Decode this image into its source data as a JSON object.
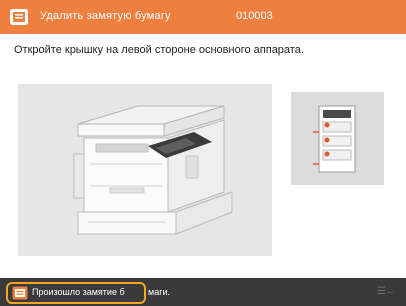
{
  "header": {
    "title": "Удалить замятую бумагу",
    "error_code": "010003",
    "accent_color": "#ef7f3f",
    "icon": "paper-jam-icon"
  },
  "instruction": "Откройте крышку на левой стороне основного аппарата.",
  "illustration": {
    "main": "printer-illustration",
    "side": "jam-location-diagram"
  },
  "footer": {
    "button_label": "Произошло замятие б",
    "button_label_tail": "маги.",
    "button_icon": "paper-jam-icon",
    "button_border_color": "#f3a51f",
    "right_text": "☰←"
  }
}
